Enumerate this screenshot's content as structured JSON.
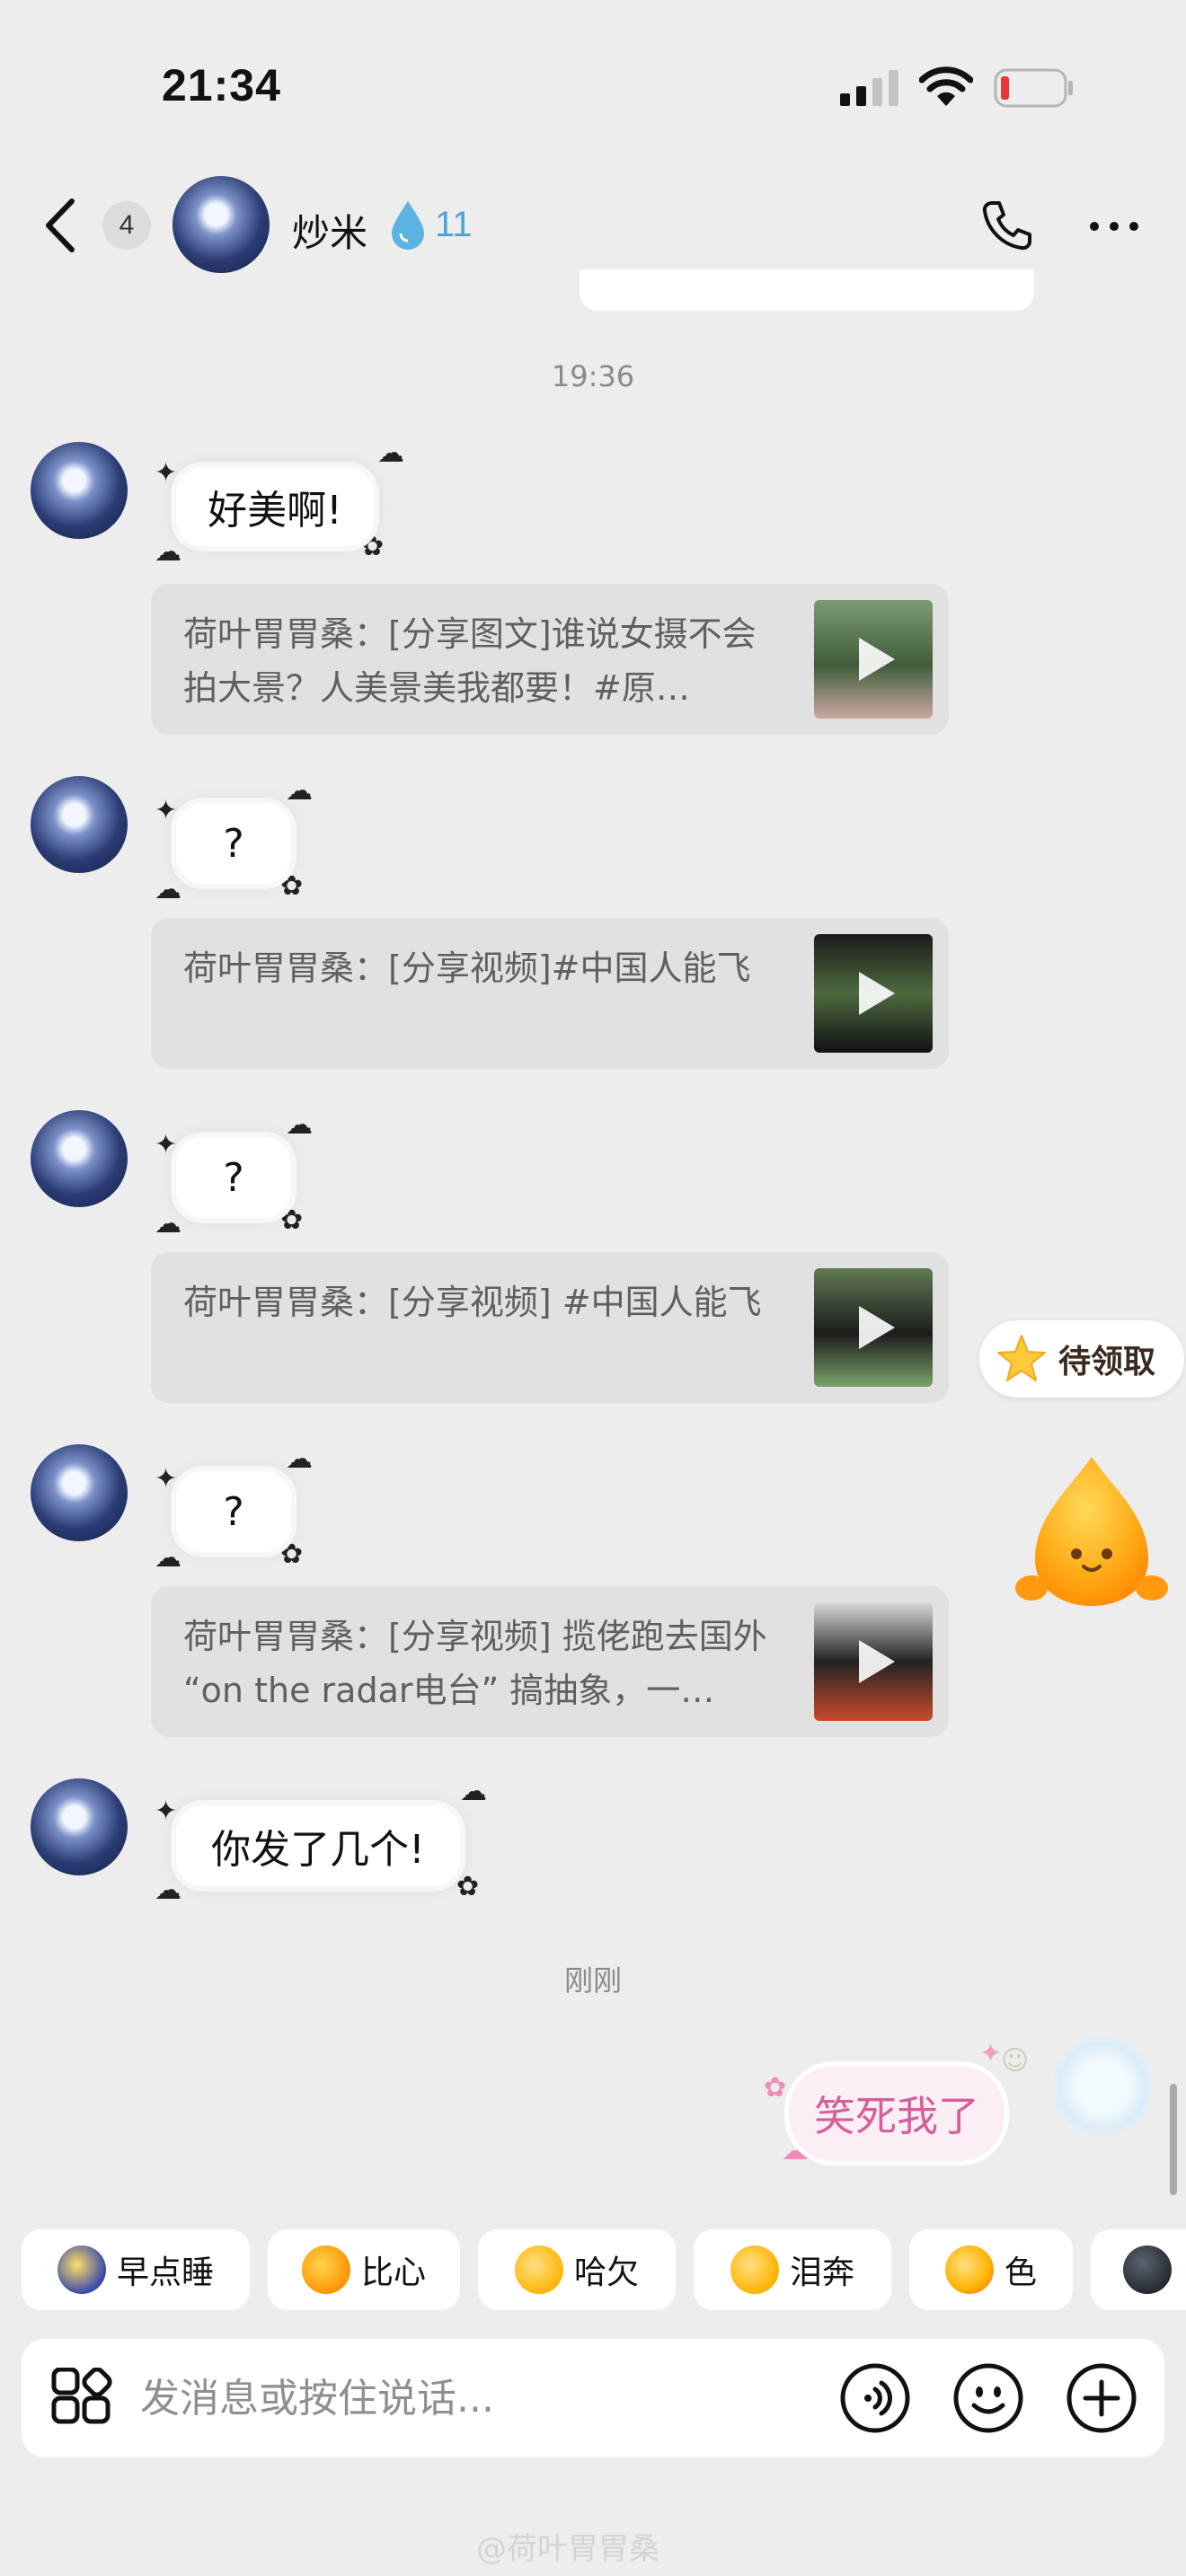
{
  "status_bar": {
    "time": "21:34"
  },
  "header": {
    "unread_count": "4",
    "contact_name": "炒米",
    "streak_count": "11"
  },
  "timestamps": [
    "19:36",
    "刚刚"
  ],
  "messages": [
    {
      "text": "好美啊!",
      "share_text": "荷叶胃胃桑：[分享图文]谁说女摄不会拍大景？人美景美我都要！#原…"
    },
    {
      "text": "?",
      "share_text": "荷叶胃胃桑：[分享视频]#中国人能飞"
    },
    {
      "text": "?",
      "share_text": "荷叶胃胃桑：[分享视频] #中国人能飞"
    },
    {
      "text": "?",
      "share_text": "荷叶胃胃桑：[分享视频] 揽佬跑去国外 “on the radar电台” 搞抽象，一…"
    },
    {
      "text": "你发了几个!"
    }
  ],
  "sent_message": "笑死我了",
  "reward": {
    "label": "待领取"
  },
  "quick_replies": [
    "早点睡",
    "比心",
    "哈欠",
    "泪奔",
    "色"
  ],
  "input": {
    "placeholder": "发消息或按住说话..."
  },
  "watermark": "@荷叶胃胃桑",
  "colors": {
    "background": "#ededed",
    "share_card": "#e1e1e1",
    "streak": "#4aa4d6",
    "sent_text": "#d45f9a"
  },
  "icons": [
    "back-arrow-icon",
    "water-drop-icon",
    "phone-icon",
    "more-icon",
    "play-icon",
    "star-icon",
    "apps-grid-icon",
    "voice-icon",
    "emoji-icon",
    "plus-icon"
  ]
}
